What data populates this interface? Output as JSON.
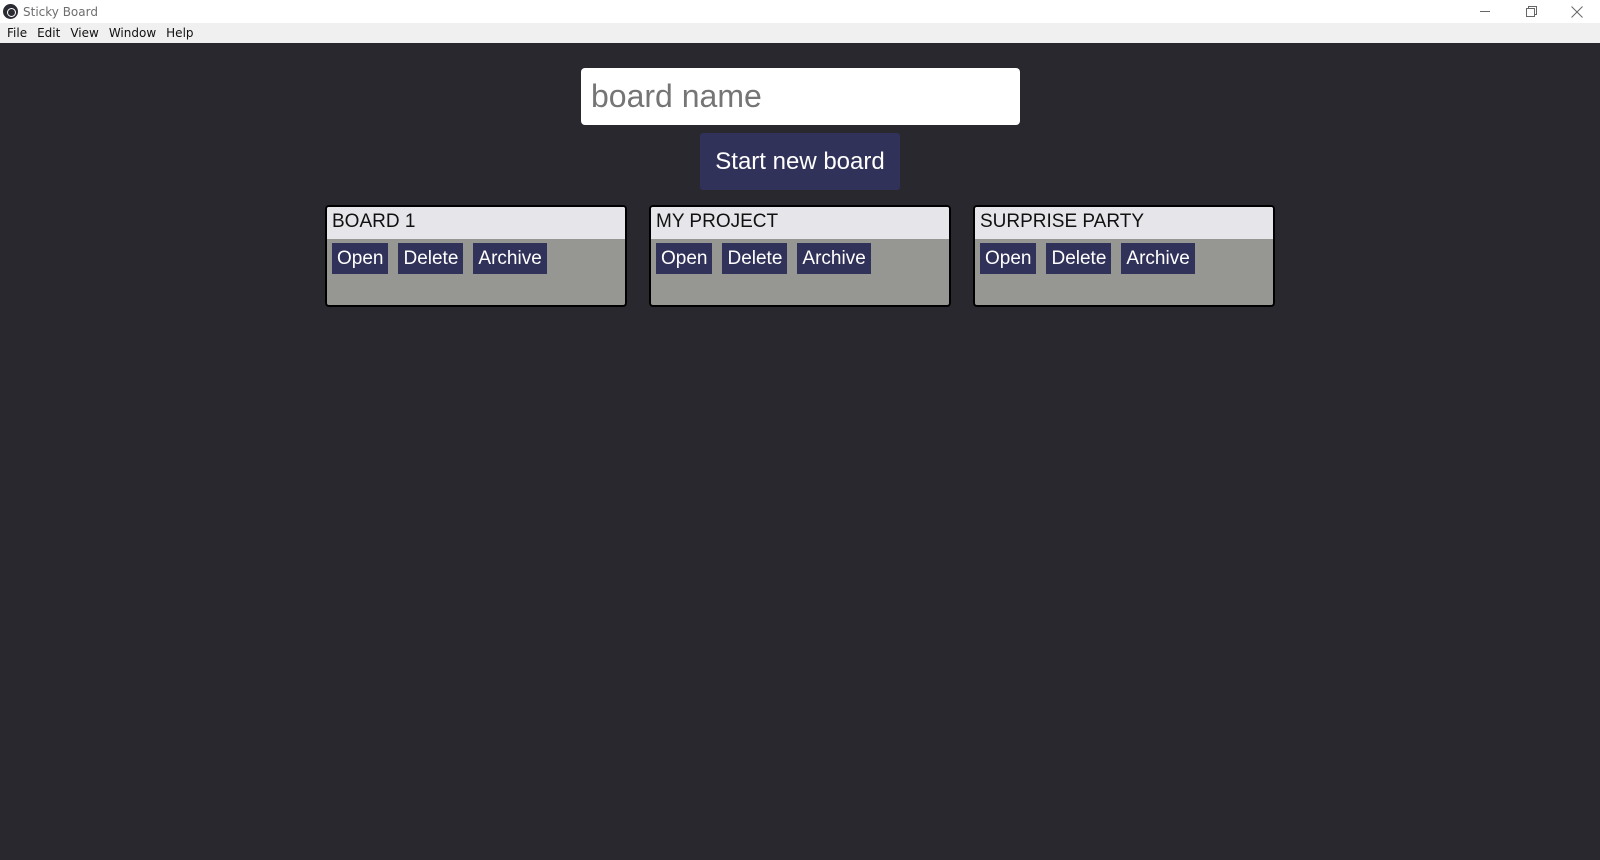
{
  "window": {
    "title": "Sticky Board",
    "controls": {
      "minimize": "minimize-icon",
      "restore": "restore-icon",
      "close": "close-icon"
    }
  },
  "menu": [
    "File",
    "Edit",
    "View",
    "Window",
    "Help"
  ],
  "form": {
    "input_value": "",
    "input_placeholder": "board name",
    "start_button": "Start new board"
  },
  "boards": [
    {
      "name": "BOARD 1",
      "actions": [
        "Open",
        "Delete",
        "Archive"
      ]
    },
    {
      "name": "MY PROJECT",
      "actions": [
        "Open",
        "Delete",
        "Archive"
      ]
    },
    {
      "name": "SURPRISE PARTY",
      "actions": [
        "Open",
        "Delete",
        "Archive"
      ]
    }
  ],
  "colors": {
    "background": "#29282e",
    "button": "#31325a",
    "card_body": "#969693",
    "card_header": "#e6e6ea"
  }
}
